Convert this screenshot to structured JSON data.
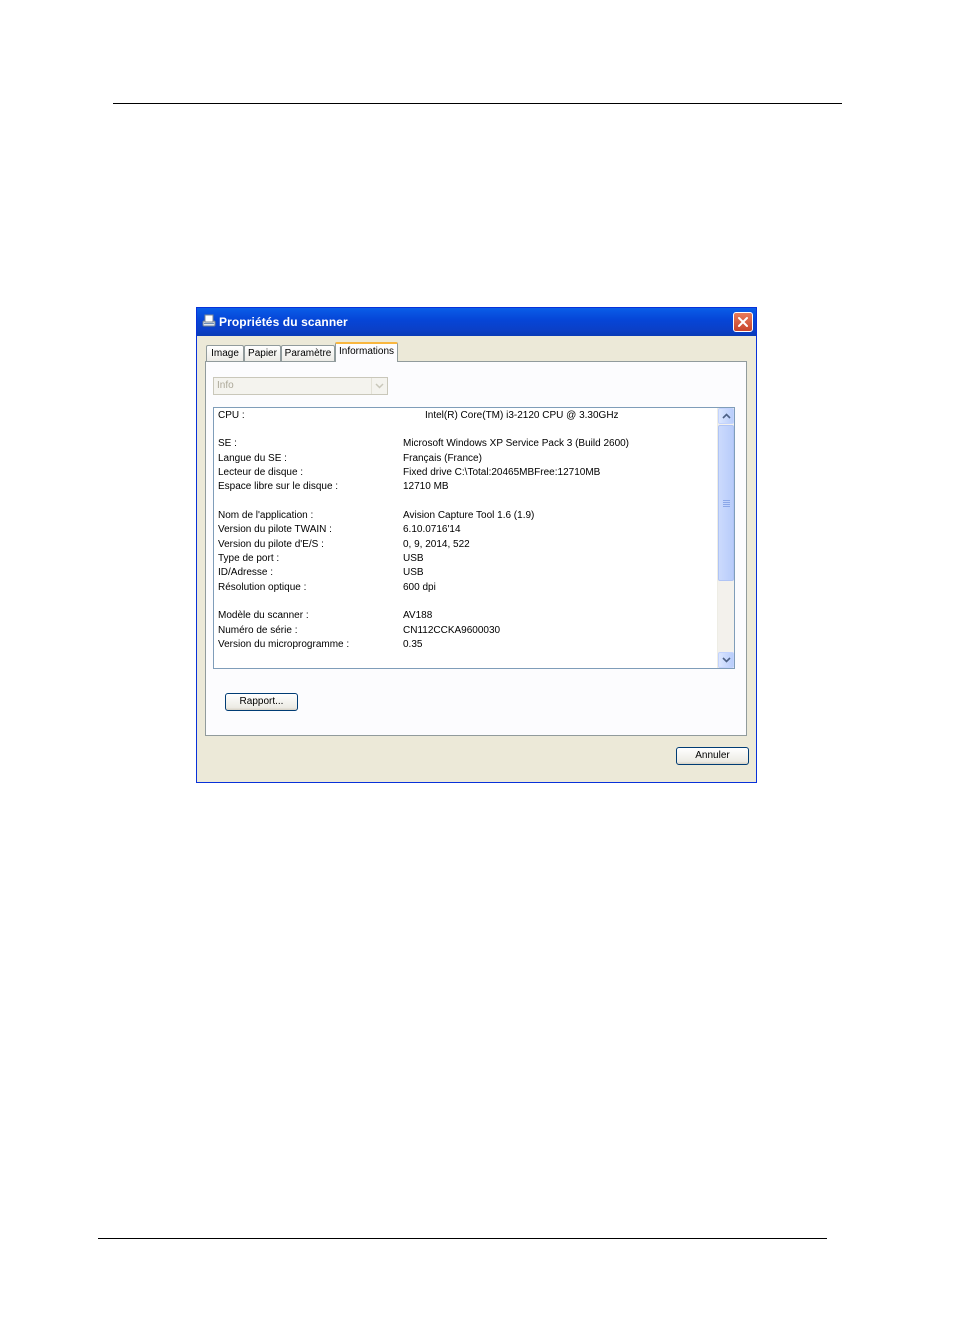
{
  "window": {
    "title": "Propriétés du scanner"
  },
  "tabs": [
    {
      "label": "Image"
    },
    {
      "label": "Papier"
    },
    {
      "label": "Paramètre"
    },
    {
      "label": "Informations"
    }
  ],
  "dropdown": {
    "selected": "Info"
  },
  "info": {
    "cpu_label": "CPU :",
    "cpu_value": "Intel(R) Core(TM) i3-2120 CPU @ 3.30GHz",
    "rows": [
      {
        "label": "SE :",
        "value": "Microsoft Windows XP Service Pack 3 (Build 2600)"
      },
      {
        "label": "Langue du SE :",
        "value": "Français (France)"
      },
      {
        "label": "Lecteur de disque :",
        "value": "Fixed drive C:\\Total:20465MBFree:12710MB"
      },
      {
        "label": "Espace libre sur le disque :",
        "value": "12710 MB"
      },
      {
        "label": "Nom de l'application :",
        "value": "Avision Capture Tool 1.6 (1.9)"
      },
      {
        "label": "Version du pilote TWAIN :",
        "value": "6.10.0716'14"
      },
      {
        "label": "Version du pilote d'E/S :",
        "value": "0, 9, 2014, 522"
      },
      {
        "label": "Type de port :",
        "value": "USB"
      },
      {
        "label": "ID/Adresse :",
        "value": "USB"
      },
      {
        "label": "Résolution optique :",
        "value": "600 dpi"
      },
      {
        "label": "Modèle du scanner :",
        "value": "AV188"
      },
      {
        "label": "Numéro de série :",
        "value": "CN112CCKA9600030"
      },
      {
        "label": "Version du microprogramme :",
        "value": "0.35"
      }
    ]
  },
  "buttons": {
    "report": "Rapport...",
    "cancel": "Annuler"
  }
}
